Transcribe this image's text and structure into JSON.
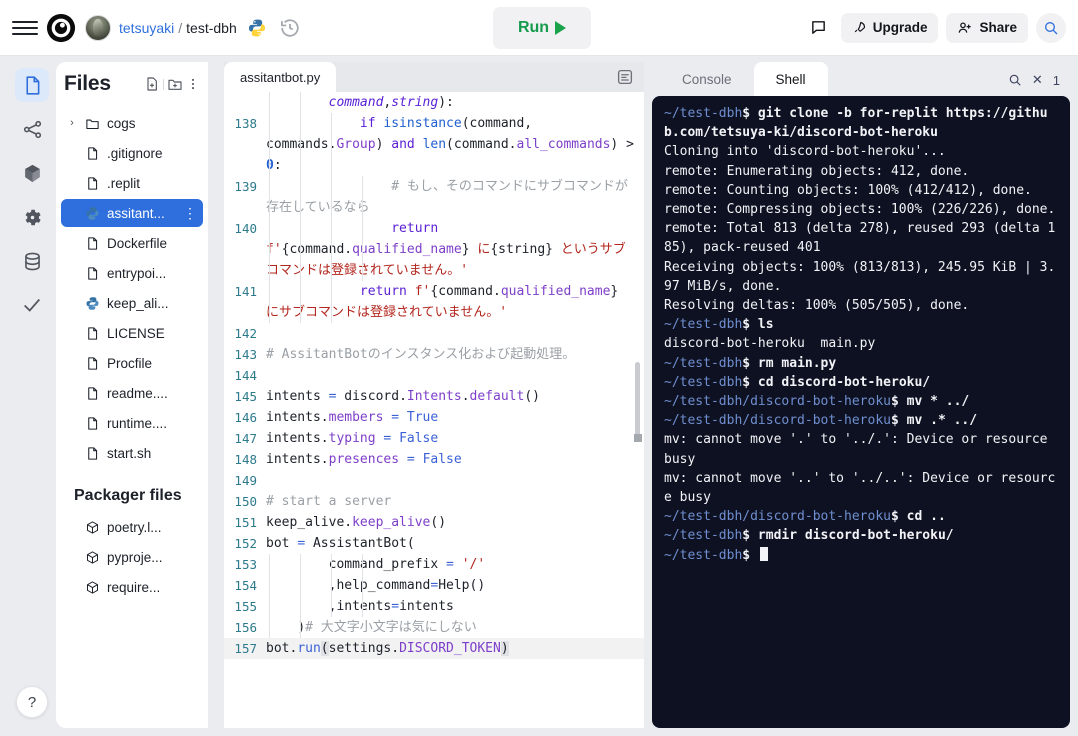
{
  "header": {
    "menu_icon": "hamburger-icon",
    "logo_icon": "replit-logo",
    "avatar_icon": "user-avatar",
    "username": "tetsuyaki",
    "separator": "/",
    "repo": "test-dbh",
    "lang_icon": "python-logo",
    "history_icon": "history-icon",
    "run_label": "Run",
    "feedback_icon": "chat-flag-icon",
    "upgrade_label": "Upgrade",
    "upgrade_icon": "rocket-icon",
    "share_label": "Share",
    "share_icon": "person-add-icon",
    "search_icon": "search-icon"
  },
  "rail": {
    "items": [
      {
        "name": "files",
        "icon": "file-icon",
        "active": true
      },
      {
        "name": "git",
        "icon": "share-nodes-icon",
        "active": false
      },
      {
        "name": "packages",
        "icon": "cube-icon",
        "active": false
      },
      {
        "name": "settings",
        "icon": "gear-icon",
        "active": false
      },
      {
        "name": "database",
        "icon": "database-icon",
        "active": false
      },
      {
        "name": "checks",
        "icon": "check-icon",
        "active": false
      }
    ]
  },
  "files": {
    "title": "Files",
    "add_file_icon": "add-file-icon",
    "add_folder_icon": "add-folder-icon",
    "more_icon": "kebab-menu-icon",
    "tree": [
      {
        "label": "cogs",
        "kind": "folder",
        "chevron": "›",
        "selected": false
      },
      {
        "label": ".gitignore",
        "kind": "file",
        "selected": false
      },
      {
        "label": ".replit",
        "kind": "file",
        "selected": false
      },
      {
        "label": "assitant...",
        "kind": "python",
        "selected": true,
        "dots": "⋮"
      },
      {
        "label": "Dockerfile",
        "kind": "file",
        "selected": false
      },
      {
        "label": "entrypoi...",
        "kind": "file",
        "selected": false
      },
      {
        "label": "keep_ali...",
        "kind": "python",
        "selected": false
      },
      {
        "label": "LICENSE",
        "kind": "file",
        "selected": false
      },
      {
        "label": "Procfile",
        "kind": "file",
        "selected": false
      },
      {
        "label": "readme....",
        "kind": "file",
        "selected": false
      },
      {
        "label": "runtime....",
        "kind": "file",
        "selected": false
      },
      {
        "label": "start.sh",
        "kind": "file",
        "selected": false
      }
    ],
    "packager_title": "Packager files",
    "packager": [
      {
        "label": "poetry.l...",
        "kind": "package"
      },
      {
        "label": "pyproje...",
        "kind": "package"
      },
      {
        "label": "require...",
        "kind": "package"
      }
    ],
    "help_label": "?"
  },
  "editor": {
    "tab_label": "assitantbot.py",
    "options_icon": "editor-options-icon",
    "lines": [
      {
        "num": "",
        "segments": [
          {
            "t": "        ",
            "c": "pl"
          },
          {
            "t": "command",
            "c": "it k"
          },
          {
            "t": ",",
            "c": "pl"
          },
          {
            "t": "string",
            "c": "it k"
          },
          {
            "t": "):",
            "c": "pl"
          }
        ],
        "guides": 2
      },
      {
        "num": "138",
        "segments": [
          {
            "t": "            ",
            "c": "pl"
          },
          {
            "t": "if ",
            "c": "k"
          },
          {
            "t": "isinstance",
            "c": "kb"
          },
          {
            "t": "(command, commands.",
            "c": "pl"
          },
          {
            "t": "Group",
            "c": "fn"
          },
          {
            "t": ") ",
            "c": "pl"
          },
          {
            "t": "and ",
            "c": "k"
          },
          {
            "t": "len",
            "c": "kb"
          },
          {
            "t": "(command.",
            "c": "pl"
          },
          {
            "t": "all_commands",
            "c": "fn"
          },
          {
            "t": ") > ",
            "c": "pl"
          },
          {
            "t": "0",
            "c": "num"
          },
          {
            "t": ":",
            "c": "pl"
          }
        ],
        "guides": 3
      },
      {
        "num": "139",
        "segments": [
          {
            "t": "                # もし、そのコマンドにサブコマンドが存在しているなら",
            "c": "cm"
          }
        ],
        "guides": 4
      },
      {
        "num": "140",
        "segments": [
          {
            "t": "                ",
            "c": "pl"
          },
          {
            "t": "return ",
            "c": "k"
          },
          {
            "t": "f'",
            "c": "st"
          },
          {
            "t": "{command.",
            "c": "pl"
          },
          {
            "t": "qualified_name",
            "c": "fn"
          },
          {
            "t": "} ",
            "c": "pl"
          },
          {
            "t": "に",
            "c": "st"
          },
          {
            "t": "{string}",
            "c": "pl"
          },
          {
            "t": " というサブコマンドは登録されていません。'",
            "c": "st"
          }
        ],
        "guides": 4
      },
      {
        "num": "141",
        "segments": [
          {
            "t": "            ",
            "c": "pl"
          },
          {
            "t": "return ",
            "c": "k"
          },
          {
            "t": "f'",
            "c": "st"
          },
          {
            "t": "{command.",
            "c": "pl"
          },
          {
            "t": "qualified_name",
            "c": "fn"
          },
          {
            "t": "}",
            "c": "pl"
          },
          {
            "t": " にサブコマンドは登録されていません。'",
            "c": "st"
          }
        ],
        "guides": 3
      },
      {
        "num": "142",
        "segments": [],
        "guides": 0
      },
      {
        "num": "143",
        "segments": [
          {
            "t": "# AssitantBotのインスタンス化および起動処理。",
            "c": "cm"
          }
        ],
        "guides": 0
      },
      {
        "num": "144",
        "segments": [],
        "guides": 0
      },
      {
        "num": "145",
        "segments": [
          {
            "t": "intents ",
            "c": "pl"
          },
          {
            "t": "=",
            "c": "op"
          },
          {
            "t": " discord.",
            "c": "pl"
          },
          {
            "t": "Intents",
            "c": "fn"
          },
          {
            "t": ".",
            "c": "pl"
          },
          {
            "t": "default",
            "c": "fn"
          },
          {
            "t": "()",
            "c": "pl"
          }
        ],
        "guides": 0
      },
      {
        "num": "146",
        "segments": [
          {
            "t": "intents.",
            "c": "pl"
          },
          {
            "t": "members",
            "c": "fn"
          },
          {
            "t": " ",
            "c": "pl"
          },
          {
            "t": "=",
            "c": "op"
          },
          {
            "t": " ",
            "c": "pl"
          },
          {
            "t": "True",
            "c": "op"
          }
        ],
        "guides": 0
      },
      {
        "num": "147",
        "segments": [
          {
            "t": "intents.",
            "c": "pl"
          },
          {
            "t": "typing",
            "c": "fn"
          },
          {
            "t": " ",
            "c": "pl"
          },
          {
            "t": "=",
            "c": "op"
          },
          {
            "t": " ",
            "c": "pl"
          },
          {
            "t": "False",
            "c": "op"
          }
        ],
        "guides": 0
      },
      {
        "num": "148",
        "segments": [
          {
            "t": "intents.",
            "c": "pl"
          },
          {
            "t": "presences",
            "c": "fn"
          },
          {
            "t": " ",
            "c": "pl"
          },
          {
            "t": "=",
            "c": "op"
          },
          {
            "t": " ",
            "c": "pl"
          },
          {
            "t": "False",
            "c": "op"
          }
        ],
        "guides": 0
      },
      {
        "num": "149",
        "segments": [],
        "guides": 0
      },
      {
        "num": "150",
        "segments": [
          {
            "t": "# start a server",
            "c": "cm"
          }
        ],
        "guides": 0
      },
      {
        "num": "151",
        "segments": [
          {
            "t": "keep_alive.",
            "c": "pl"
          },
          {
            "t": "keep_alive",
            "c": "fn"
          },
          {
            "t": "()",
            "c": "pl"
          }
        ],
        "guides": 0
      },
      {
        "num": "152",
        "segments": [
          {
            "t": "bot ",
            "c": "pl"
          },
          {
            "t": "=",
            "c": "op"
          },
          {
            "t": " AssistantBot(",
            "c": "pl"
          }
        ],
        "guides": 0
      },
      {
        "num": "153",
        "segments": [
          {
            "t": "        command_prefix ",
            "c": "pl"
          },
          {
            "t": "=",
            "c": "op"
          },
          {
            "t": " ",
            "c": "pl"
          },
          {
            "t": "'/'",
            "c": "st"
          }
        ],
        "guides": 4
      },
      {
        "num": "154",
        "segments": [
          {
            "t": "        ,help_command",
            "c": "pl"
          },
          {
            "t": "=",
            "c": "op"
          },
          {
            "t": "Help()",
            "c": "pl"
          }
        ],
        "guides": 4
      },
      {
        "num": "155",
        "segments": [
          {
            "t": "        ,intents",
            "c": "pl"
          },
          {
            "t": "=",
            "c": "op"
          },
          {
            "t": "intents",
            "c": "pl"
          }
        ],
        "guides": 4
      },
      {
        "num": "156",
        "segments": [
          {
            "t": "    )",
            "c": "pl"
          },
          {
            "t": "# 大文字小文字は気にしない",
            "c": "cm"
          }
        ],
        "guides": 2
      },
      {
        "num": "157",
        "segments": [
          {
            "t": "bot.",
            "c": "pl"
          },
          {
            "t": "run",
            "c": "op"
          },
          {
            "t": "(",
            "c": "cursor-paren"
          },
          {
            "t": "settings.",
            "c": "pl"
          },
          {
            "t": "DISCORD_TOKEN",
            "c": "fn"
          },
          {
            "t": ")",
            "c": "cursor-paren"
          }
        ],
        "guides": 0,
        "highlight": true
      }
    ]
  },
  "terminal": {
    "tabs": [
      {
        "label": "Console",
        "active": false
      },
      {
        "label": "Shell",
        "active": true
      }
    ],
    "overlay": {
      "search_icon": "search-icon",
      "close_icon": "close-icon",
      "extra": "1"
    },
    "lines": [
      {
        "prompt": "~/test-dbh",
        "cmd": "$ git clone -b for-replit https://github.com/tetsuya-ki/discord-bot-heroku"
      },
      {
        "out": "Cloning into 'discord-bot-heroku'..."
      },
      {
        "out": "remote: Enumerating objects: 412, done."
      },
      {
        "out": "remote: Counting objects: 100% (412/412), done."
      },
      {
        "out": "remote: Compressing objects: 100% (226/226), done."
      },
      {
        "out": "remote: Total 813 (delta 278), reused 293 (delta 185), pack-reused 401"
      },
      {
        "out": "Receiving objects: 100% (813/813), 245.95 KiB | 3.97 MiB/s, done."
      },
      {
        "out": "Resolving deltas: 100% (505/505), done."
      },
      {
        "prompt": "~/test-dbh",
        "cmd": "$ ls"
      },
      {
        "out": "discord-bot-heroku  main.py"
      },
      {
        "prompt": "~/test-dbh",
        "cmd": "$ rm main.py"
      },
      {
        "prompt": "~/test-dbh",
        "cmd": "$ cd discord-bot-heroku/"
      },
      {
        "prompt": "~/test-dbh/discord-bot-heroku",
        "cmd": "$ mv * ../"
      },
      {
        "prompt": "~/test-dbh/discord-bot-heroku",
        "cmd": "$ mv .* ../"
      },
      {
        "out": "mv: cannot move '.' to '../.': Device or resource busy"
      },
      {
        "out": "mv: cannot move '..' to '../..': Device or resource busy"
      },
      {
        "prompt": "~/test-dbh/discord-bot-heroku",
        "cmd": "$ cd .."
      },
      {
        "prompt": "~/test-dbh",
        "cmd": "$ rmdir discord-bot-heroku/"
      },
      {
        "prompt": "~/test-dbh",
        "cmd": "$ ",
        "caret": true
      }
    ]
  },
  "colors": {
    "accent_blue": "#2f6fdd",
    "run_green": "#1aa34a",
    "terminal_bg": "#0e1121",
    "prompt_blue": "#6f8fd0",
    "panel_bg": "#ebecf0"
  }
}
